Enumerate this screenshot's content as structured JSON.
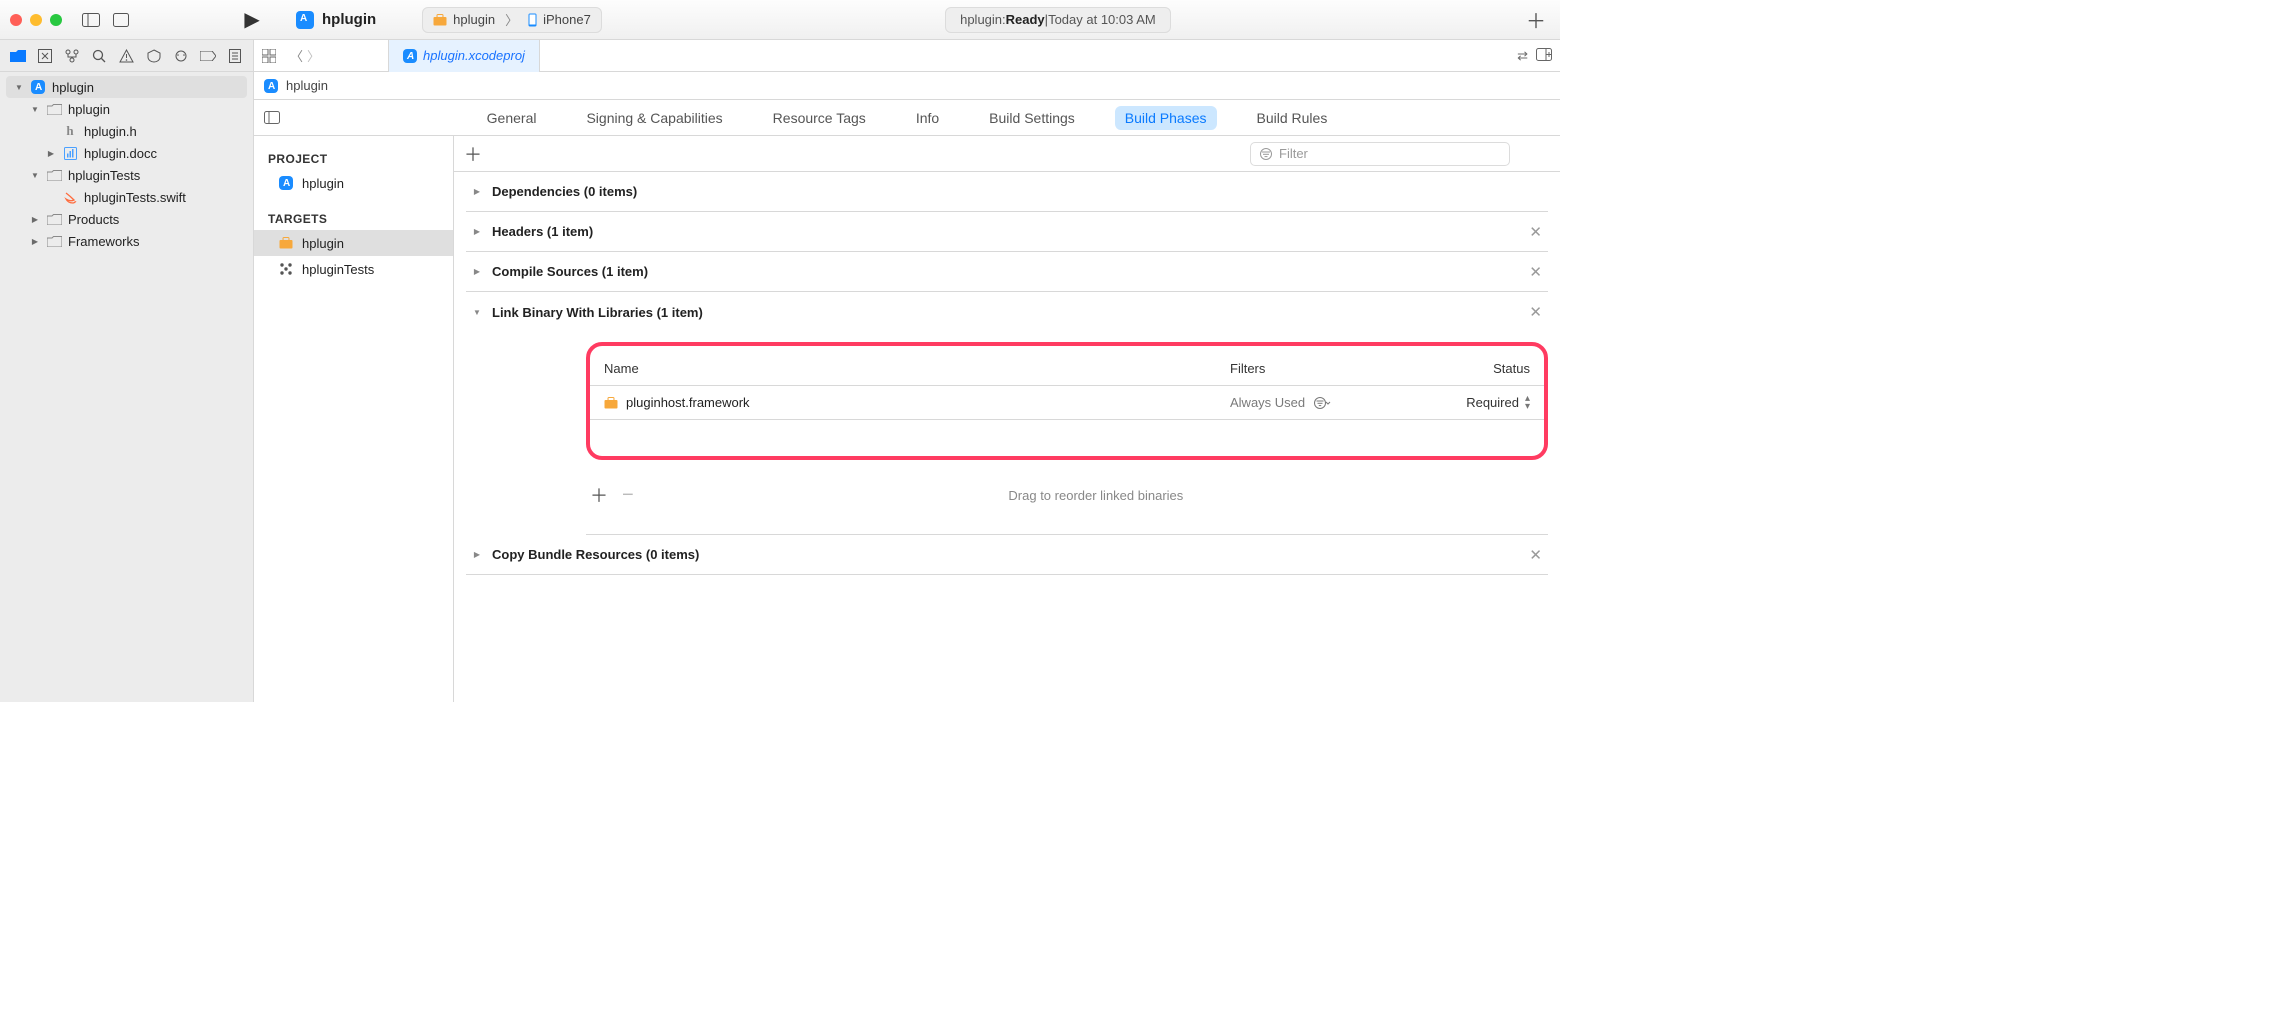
{
  "titlebar": {
    "project_name": "hplugin",
    "scheme": {
      "name": "hplugin",
      "device": "iPhone7"
    },
    "status": {
      "prefix": "hplugin: ",
      "state": "Ready",
      "separator": " | ",
      "time": "Today at 10:03 AM"
    }
  },
  "navigator": {
    "root": "hplugin",
    "items": {
      "folder_hplugin": "hplugin",
      "file_h": "hplugin.h",
      "file_docc": "hplugin.docc",
      "folder_tests": "hpluginTests",
      "file_tests_swift": "hpluginTests.swift",
      "folder_products": "Products",
      "folder_frameworks": "Frameworks"
    }
  },
  "editor": {
    "open_tab": "hplugin.xcodeproj",
    "crumb": "hplugin"
  },
  "project_editor": {
    "tabs": {
      "general": "General",
      "signing": "Signing & Capabilities",
      "resource_tags": "Resource Tags",
      "info": "Info",
      "build_settings": "Build Settings",
      "build_phases": "Build Phases",
      "build_rules": "Build Rules"
    },
    "targets_pane": {
      "project_header": "PROJECT",
      "project_name": "hplugin",
      "targets_header": "TARGETS",
      "target1": "hplugin",
      "target2": "hpluginTests"
    },
    "filter_placeholder": "Filter",
    "phases": {
      "dependencies": "Dependencies (0 items)",
      "headers": "Headers (1 item)",
      "compile": "Compile Sources (1 item)",
      "link": "Link Binary With Libraries (1 item)",
      "copy": "Copy Bundle Resources (0 items)"
    },
    "link_table": {
      "col_name": "Name",
      "col_filters": "Filters",
      "col_status": "Status",
      "row1_name": "pluginhost.framework",
      "row1_filters": "Always Used",
      "row1_status": "Required"
    },
    "drag_hint": "Drag to reorder linked binaries"
  }
}
